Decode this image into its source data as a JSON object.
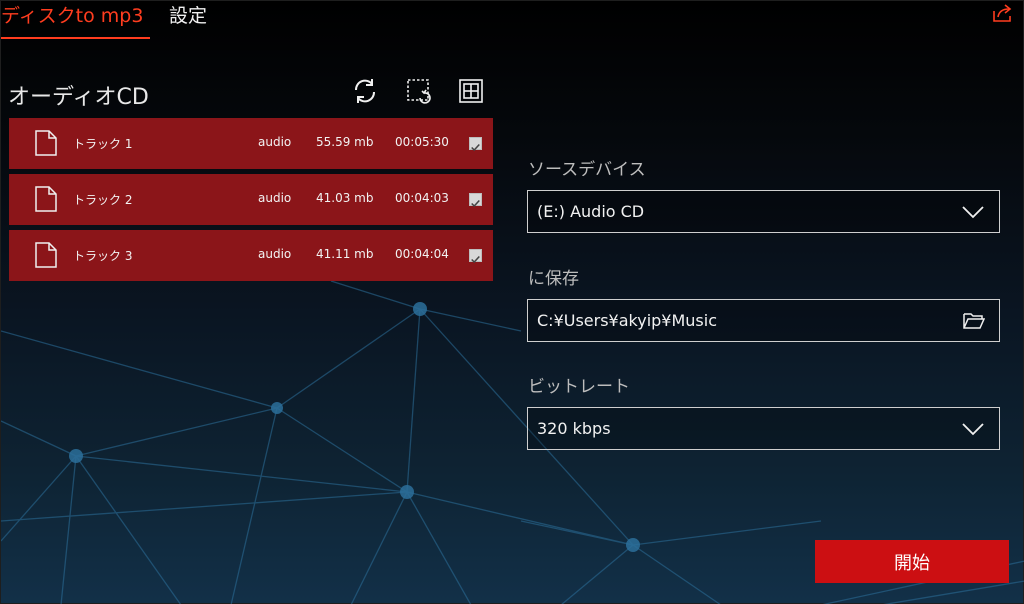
{
  "tabs": [
    {
      "label": "ディスクto mp3",
      "active": true
    },
    {
      "label": "設定",
      "active": false
    }
  ],
  "header": {
    "share_icon": "share-icon"
  },
  "panel": {
    "title": "オーディオCD",
    "tools": [
      "refresh-icon",
      "select-region-icon",
      "grid-icon"
    ]
  },
  "tracks": [
    {
      "name": "トラック 1",
      "type": "audio",
      "size": "55.59 mb",
      "duration": "00:05:30",
      "checked": true
    },
    {
      "name": "トラック 2",
      "type": "audio",
      "size": "41.03 mb",
      "duration": "00:04:03",
      "checked": true
    },
    {
      "name": "トラック 3",
      "type": "audio",
      "size": "41.11 mb",
      "duration": "00:04:04",
      "checked": true
    }
  ],
  "form": {
    "source_label": "ソースデバイス",
    "source_value": "(E:) Audio CD",
    "save_label": "に保存",
    "save_value": "C:¥Users¥akyip¥Music",
    "bitrate_label": "ビットレート",
    "bitrate_value": "320  kbps"
  },
  "start_label": "開始",
  "colors": {
    "accent": "#ff3d1f",
    "track_bg": "#8b1519",
    "start_button": "#cc0f12",
    "background_dark": "#000000",
    "background_blue": "#123048"
  }
}
